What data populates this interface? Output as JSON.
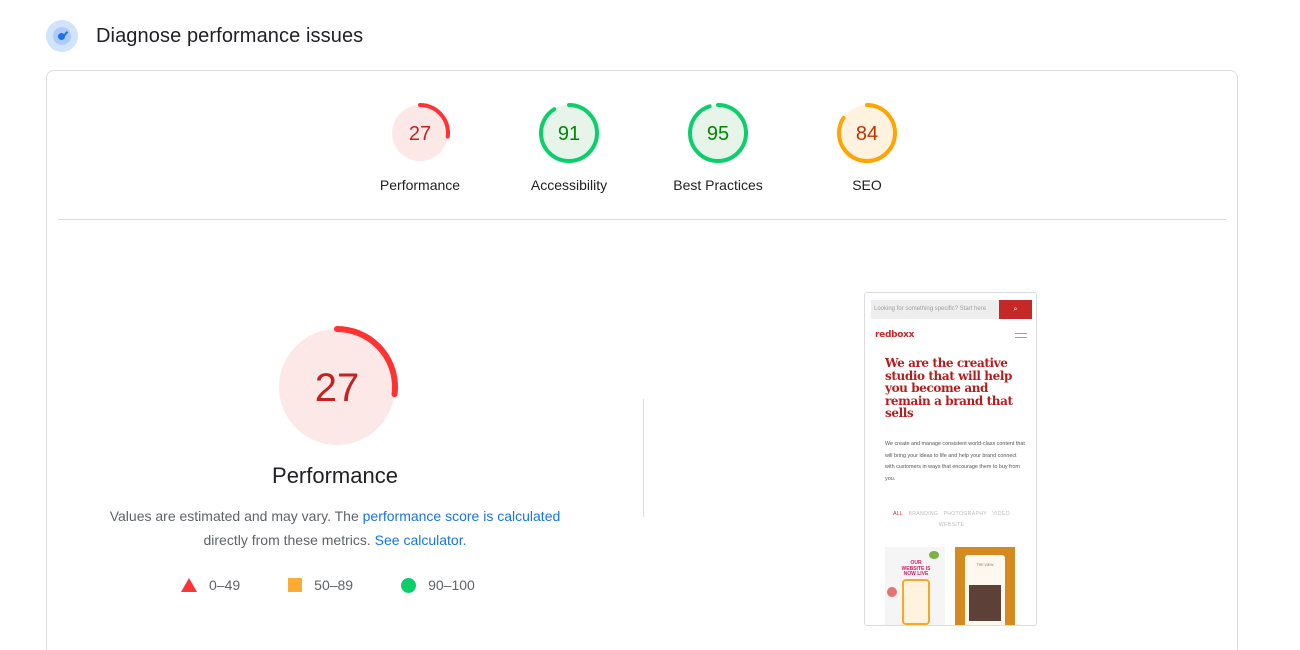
{
  "section": {
    "title": "Diagnose performance issues",
    "icon": "gauge-icon"
  },
  "colors": {
    "fail": "#ff3333",
    "fail_text": "#c5221f",
    "fail_bg": "#fde8e8",
    "average": "#ffa400",
    "average_text": "#c33300",
    "average_bg": "#fff3e0",
    "pass": "#0cce6b",
    "pass_text": "#008800",
    "pass_bg": "#e6f4ea",
    "link": "#1a73e8"
  },
  "gauges": [
    {
      "label": "Performance",
      "score": 27,
      "rating": "fail"
    },
    {
      "label": "Accessibility",
      "score": 91,
      "rating": "pass"
    },
    {
      "label": "Best Practices",
      "score": 95,
      "rating": "pass"
    },
    {
      "label": "SEO",
      "score": 84,
      "rating": "average"
    }
  ],
  "main": {
    "score": 27,
    "title": "Performance",
    "note": {
      "text1": "Values are estimated and may vary. The",
      "link1": "performance score is calculated",
      "text2": "directly from these metrics.",
      "link2": "See calculator."
    },
    "legend": [
      {
        "icon": "triangle-icon",
        "range": "0–49"
      },
      {
        "icon": "square-icon",
        "range": "50–89"
      },
      {
        "icon": "circle-icon",
        "range": "90–100"
      }
    ]
  },
  "screenshot": {
    "search_placeholder": "Looking for something specific? Start here",
    "search_icon": "⌕",
    "logo": "redboxx",
    "headline": "We are the creative studio that will help you become and remain a brand that sells",
    "body": "We create and manage consistent world-class content that will bring your ideas to life and help your brand connect with customers in ways that encourage them to buy from you.",
    "tabs": [
      "ALL",
      "BRANDING",
      "PHOTOGRAPHY",
      "VIDEO",
      "WEBSITE"
    ],
    "img1_text": "OUR WEBSITE IS NOW LIVE",
    "img2_text": "THE VIEW"
  }
}
